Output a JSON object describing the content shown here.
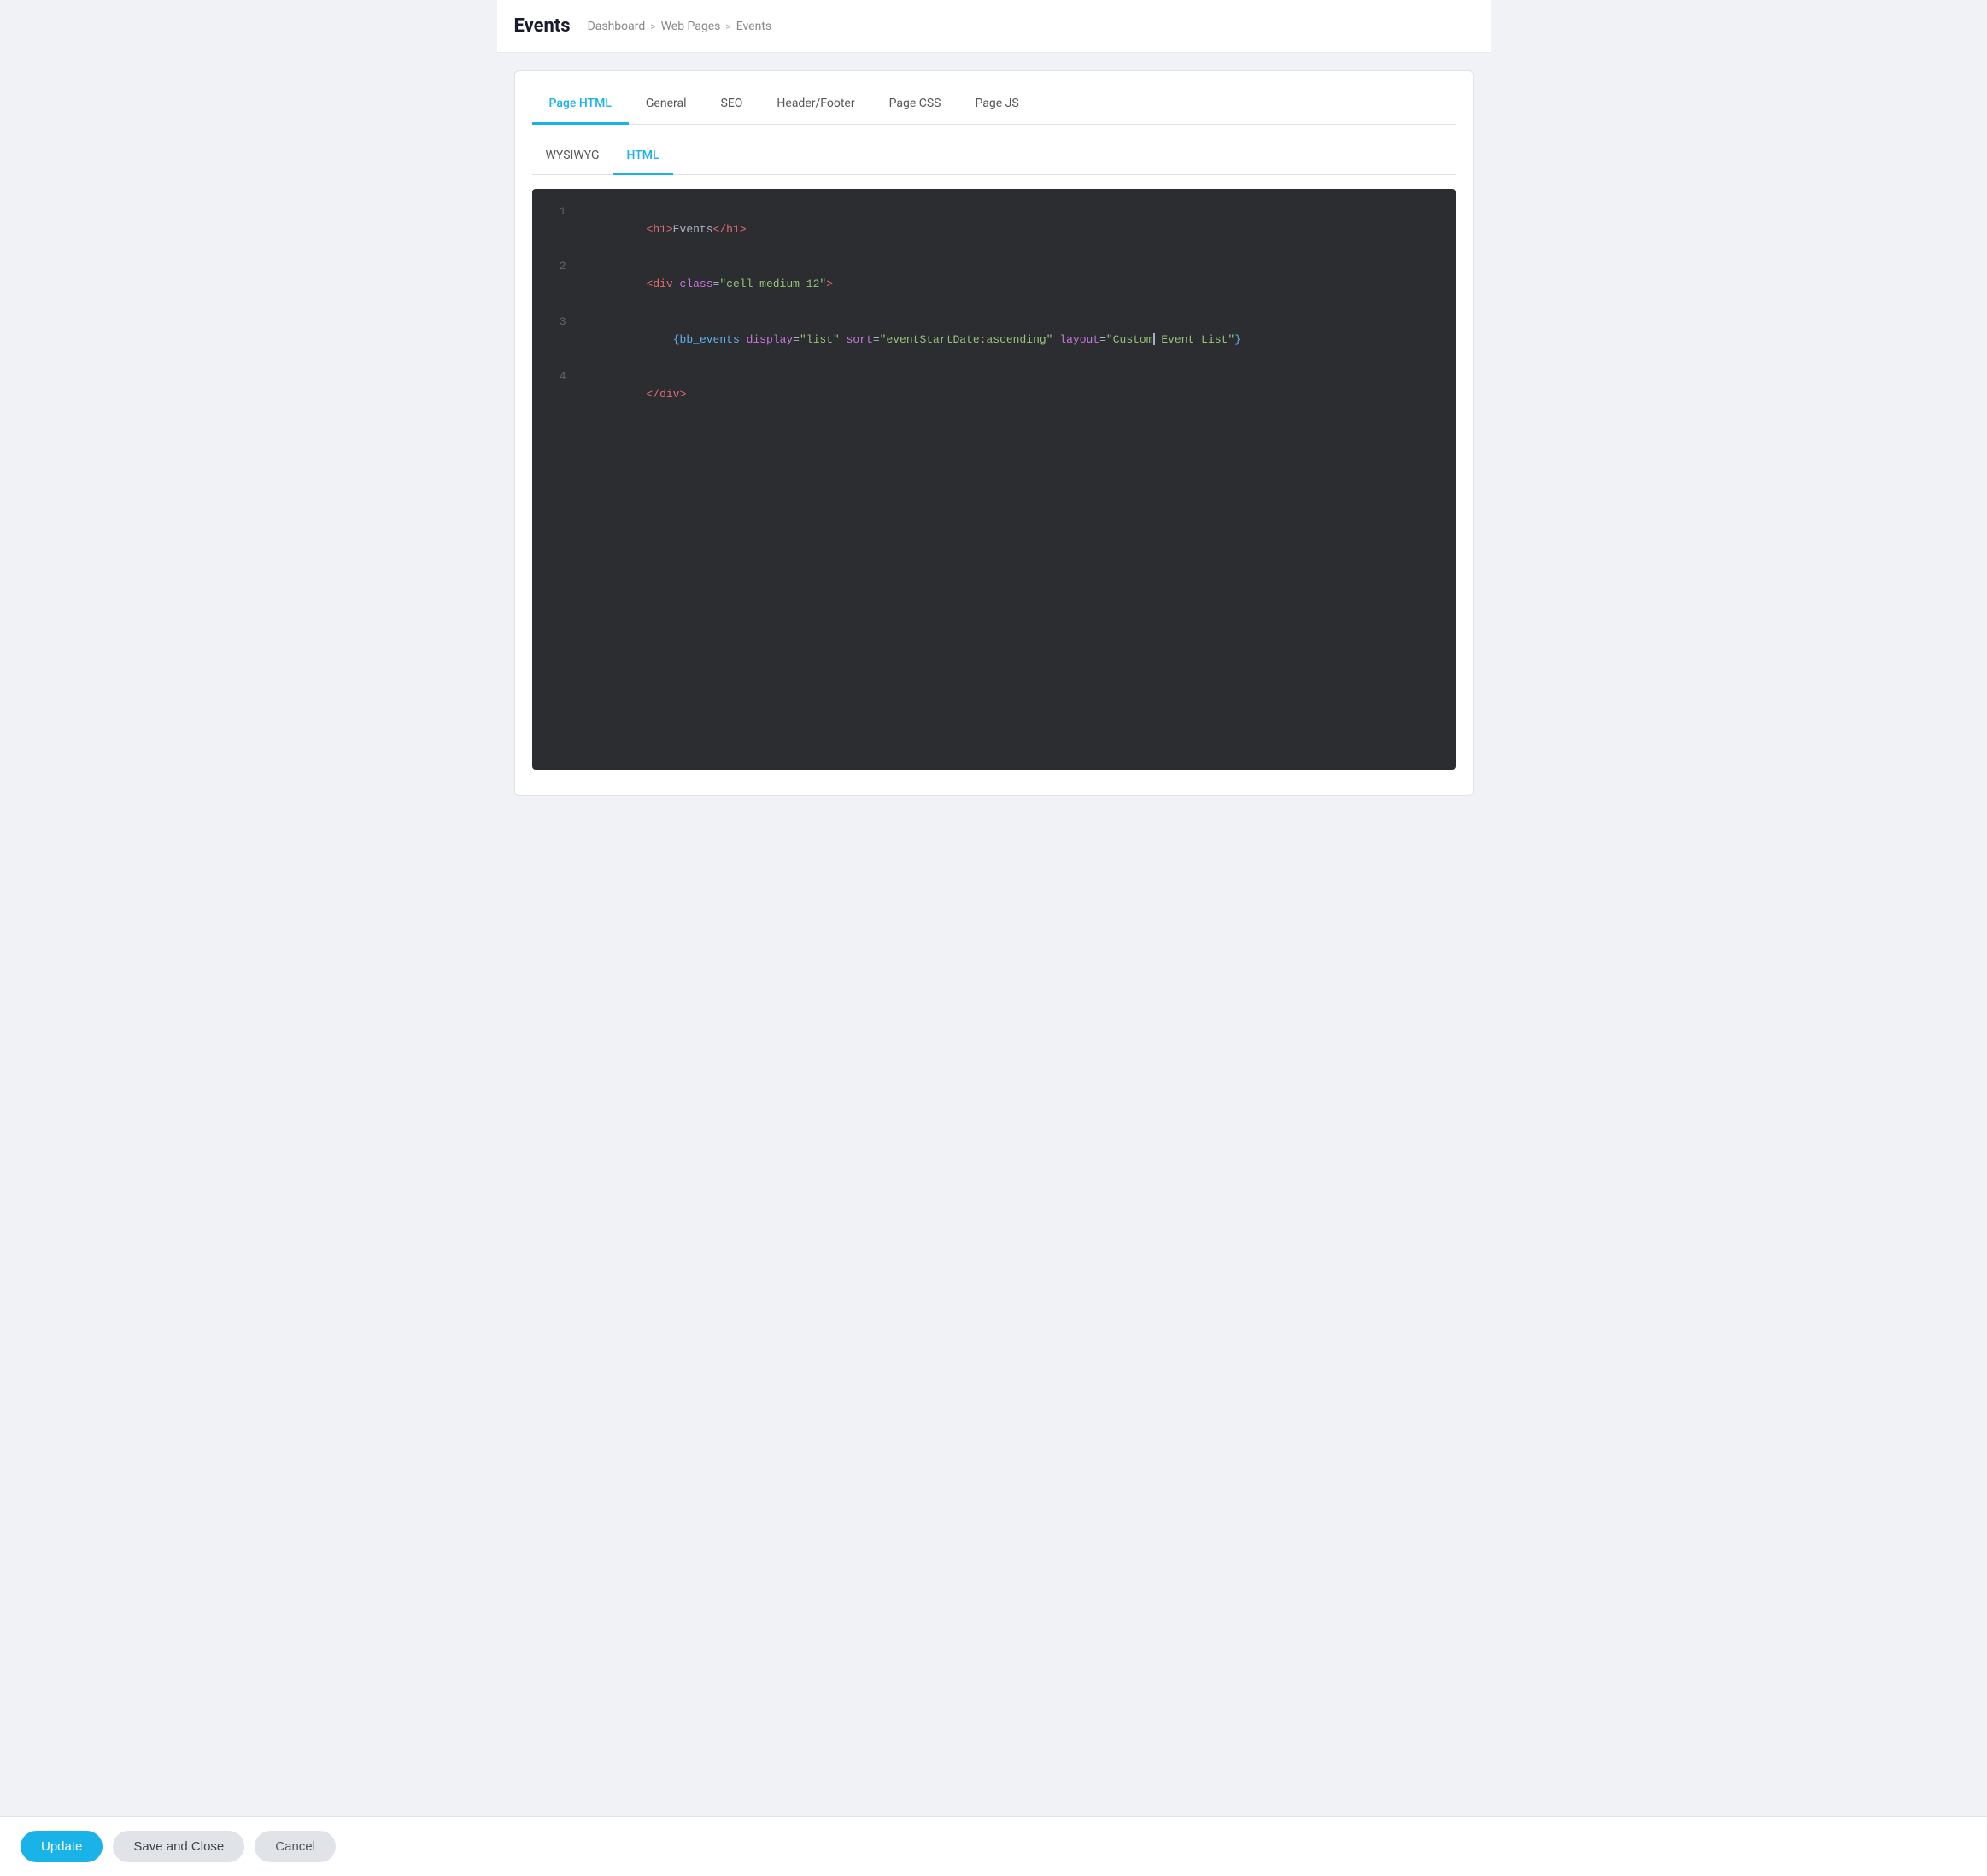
{
  "header": {
    "title": "Events",
    "breadcrumb": {
      "items": [
        "Dashboard",
        "Web Pages",
        "Events"
      ],
      "separators": [
        ">",
        ">"
      ]
    }
  },
  "top_tabs": {
    "items": [
      {
        "label": "Page HTML",
        "active": true
      },
      {
        "label": "General",
        "active": false
      },
      {
        "label": "SEO",
        "active": false
      },
      {
        "label": "Header/Footer",
        "active": false
      },
      {
        "label": "Page CSS",
        "active": false
      },
      {
        "label": "Page JS",
        "active": false
      }
    ]
  },
  "sub_tabs": {
    "items": [
      {
        "label": "WYSIWYG",
        "active": false
      },
      {
        "label": "HTML",
        "active": true
      }
    ]
  },
  "code_editor": {
    "lines": [
      {
        "number": "1",
        "parts": [
          {
            "type": "tag",
            "text": "<h1>"
          },
          {
            "type": "text",
            "text": "Events"
          },
          {
            "type": "tag",
            "text": "</h1>"
          }
        ]
      },
      {
        "number": "2",
        "parts": [
          {
            "type": "tag",
            "text": "<div "
          },
          {
            "type": "attr-name",
            "text": "class"
          },
          {
            "type": "bracket",
            "text": "="
          },
          {
            "type": "attr-value",
            "text": "\"cell medium-12\""
          },
          {
            "type": "tag",
            "text": ">"
          }
        ]
      },
      {
        "number": "3",
        "parts": [
          {
            "type": "indent",
            "text": "    "
          },
          {
            "type": "shortcode-tag",
            "text": "{bb_events "
          },
          {
            "type": "attr-name",
            "text": "display"
          },
          {
            "type": "bracket",
            "text": "="
          },
          {
            "type": "attr-value",
            "text": "\"list\""
          },
          {
            "type": "text",
            "text": " "
          },
          {
            "type": "attr-name",
            "text": "sort"
          },
          {
            "type": "bracket",
            "text": "="
          },
          {
            "type": "attr-value",
            "text": "\"eventStartDate:ascending\""
          },
          {
            "type": "text",
            "text": " "
          },
          {
            "type": "attr-name",
            "text": "layout"
          },
          {
            "type": "bracket",
            "text": "="
          },
          {
            "type": "attr-value",
            "text": "\"Custom"
          },
          {
            "type": "cursor",
            "text": ""
          },
          {
            "type": "attr-value-cont",
            "text": " Event List\""
          },
          {
            "type": "shortcode-tag",
            "text": "}"
          }
        ]
      },
      {
        "number": "4",
        "parts": [
          {
            "type": "tag",
            "text": "</div>"
          }
        ]
      }
    ]
  },
  "action_bar": {
    "update_label": "Update",
    "save_close_label": "Save and Close",
    "cancel_label": "Cancel"
  }
}
